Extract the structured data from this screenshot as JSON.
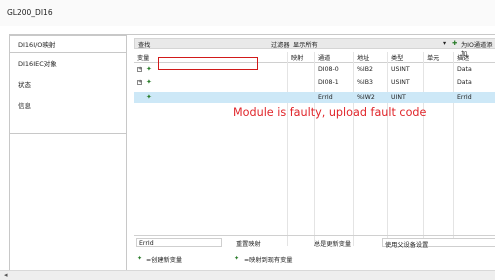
{
  "window": {
    "title": "GL200_DI16"
  },
  "sidebar": {
    "items": [
      {
        "label": "DI16I/O映射"
      },
      {
        "label": "DI16IEC对象"
      },
      {
        "label": "状态"
      },
      {
        "label": "信息"
      }
    ]
  },
  "toolbar": {
    "find_label": "查找",
    "filter_label": "过滤器",
    "show_all": "显示所有",
    "add_fb_label": "为IO通道添加"
  },
  "table": {
    "headers": {
      "variable": "变量",
      "mapping": "映射",
      "channel": "通道",
      "address": "地址",
      "type": "类型",
      "unit": "单元",
      "description": "描述"
    },
    "rows": [
      {
        "expander": "+",
        "variable": "",
        "mapping": "",
        "channel": "DI08-0",
        "address": "%IB2",
        "type": "USINT",
        "unit": "",
        "description": "Data"
      },
      {
        "expander": "+",
        "variable": "",
        "mapping": "",
        "channel": "DI08-1",
        "address": "%IB3",
        "type": "USINT",
        "unit": "",
        "description": "Data"
      },
      {
        "expander": "",
        "variable": "",
        "mapping": "",
        "channel": "ErrId",
        "address": "%IW2",
        "type": "UINT",
        "unit": "",
        "description": "ErrId"
      }
    ]
  },
  "annotation": {
    "text": "Module is faulty, upload fault code"
  },
  "bottom": {
    "selected_field": "ErrId",
    "reset_mapping": "重置映射",
    "always_update": "总是更新变量",
    "use_parent": "使用父设备设置"
  },
  "legend": {
    "new_variable": "=创建新变量",
    "map_existing": "=映射到现有变量"
  },
  "colors": {
    "highlight": "#cde8f7",
    "annotation": "#e0262b"
  }
}
